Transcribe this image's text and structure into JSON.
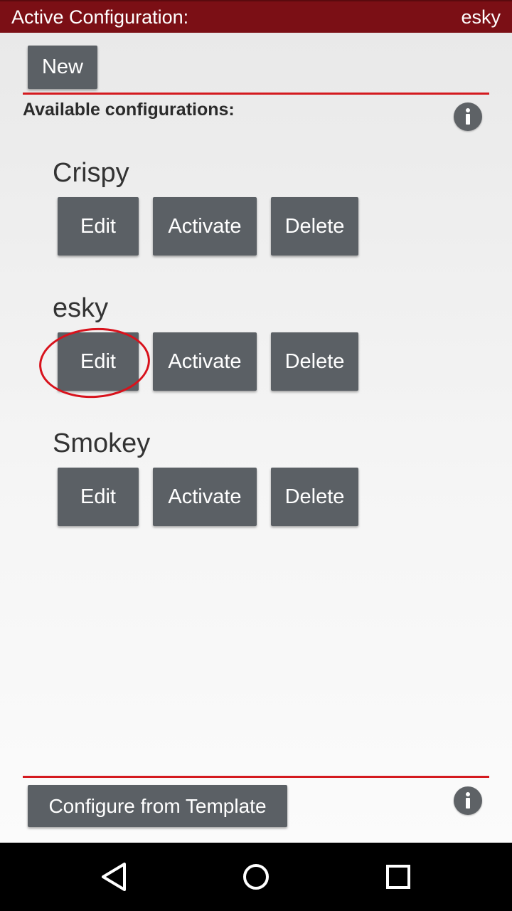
{
  "titlebar": {
    "label": "Active Configuration:",
    "active_name": "esky"
  },
  "toolbar": {
    "new_label": "New"
  },
  "section": {
    "label": "Available configurations:",
    "info_icon": "info-icon"
  },
  "configurations": [
    {
      "name": "Crispy",
      "edit_label": "Edit",
      "activate_label": "Activate",
      "delete_label": "Delete"
    },
    {
      "name": "esky",
      "edit_label": "Edit",
      "activate_label": "Activate",
      "delete_label": "Delete",
      "highlighted_button": "Edit"
    },
    {
      "name": "Smokey",
      "edit_label": "Edit",
      "activate_label": "Activate",
      "delete_label": "Delete"
    }
  ],
  "footer": {
    "template_label": "Configure from Template",
    "info_icon": "info-icon"
  },
  "navbar": {
    "icons": [
      "back-icon",
      "home-icon",
      "recents-icon"
    ]
  },
  "colors": {
    "titlebar_bg": "#7b0f15",
    "accent_line": "#d41a1f",
    "button_bg": "#5b6065",
    "highlight_circle": "#d8121c"
  }
}
